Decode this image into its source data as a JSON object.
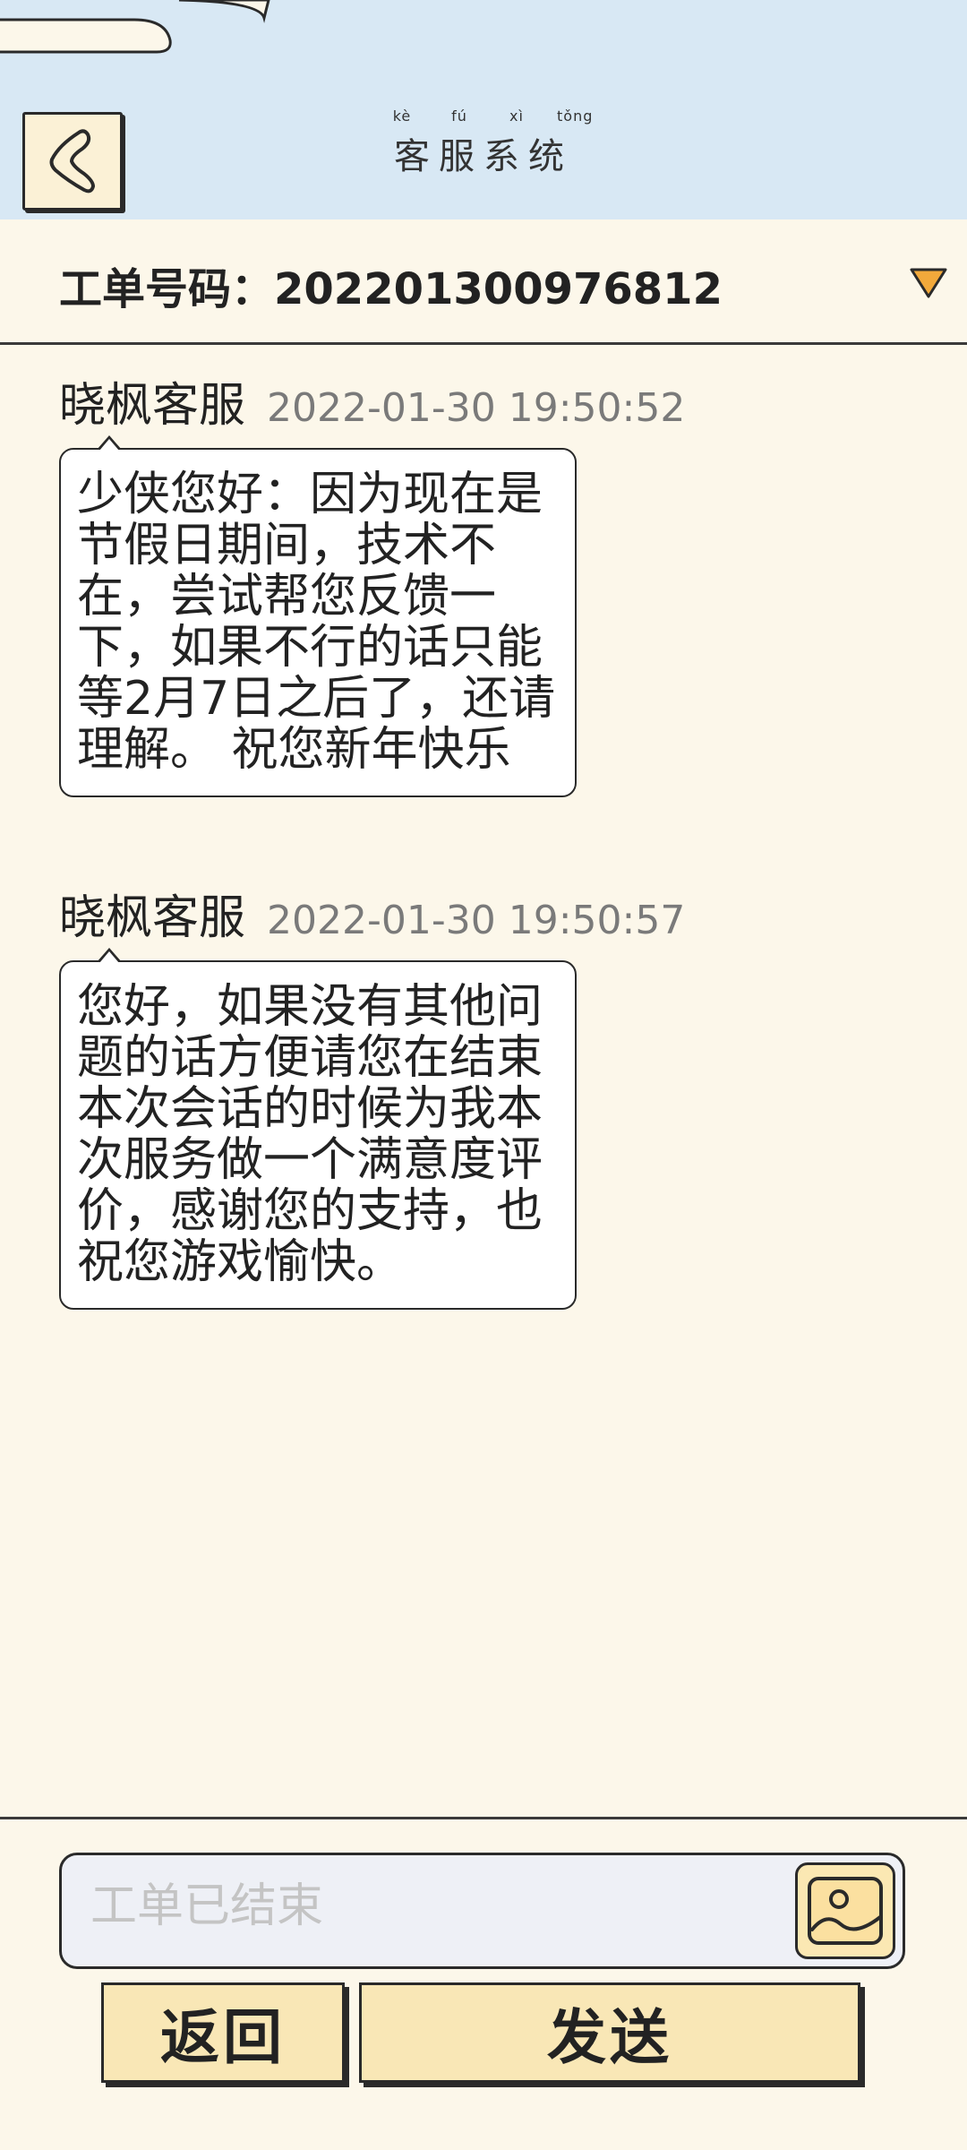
{
  "header": {
    "title": "客服系统",
    "pinyin": [
      "kè",
      "fú",
      "xì",
      "tǒng"
    ]
  },
  "ticket": {
    "label": "工单号码：202201300976812"
  },
  "messages": [
    {
      "sender": "晓枫客服",
      "time": "2022-01-30 19:50:52",
      "text": "少侠您好：因为现在是节假日期间，技术不在，尝试帮您反馈一下，如果不行的话只能等2月7日之后了，还请理解。 祝您新年快乐"
    },
    {
      "sender": "晓枫客服",
      "time": "2022-01-30 19:50:57",
      "text": "您好，如果没有其他问题的话方便请您在结束本次会话的时候为我本次服务做一个满意度评价，感谢您的支持，也祝您游戏愉快。"
    }
  ],
  "input": {
    "placeholder": "工单已结束"
  },
  "buttons": {
    "return_label": "返回",
    "send_label": "发送"
  },
  "colors": {
    "header_bg": "#d8e8f4",
    "page_bg": "#fcf7ea",
    "button_bg": "#f9e7b6",
    "dropdown_fill": "#f2a93b"
  },
  "icons": {
    "back": "chevron-left-icon",
    "dropdown": "triangle-down-icon",
    "image": "image-icon"
  }
}
